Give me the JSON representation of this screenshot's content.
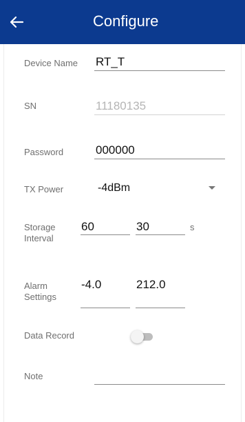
{
  "app_bar": {
    "title": "Configure",
    "back_icon": "arrow-left-icon",
    "background": "#0c3a8f"
  },
  "form": {
    "device_name": {
      "label": "Device Name",
      "value": "RT_T"
    },
    "sn": {
      "label": "SN",
      "value": "11180135"
    },
    "password": {
      "label": "Password",
      "value": "000000"
    },
    "tx_power": {
      "label": "TX Power",
      "value": "-4dBm",
      "dropdown_icon": "caret-down-icon"
    },
    "storage_interval": {
      "label_line1": "Storage",
      "label_line2": "Interval",
      "value_1": "60",
      "value_2": "30",
      "unit": "s"
    },
    "alarm_settings": {
      "label_line1": "Alarm",
      "label_line2": "Settings",
      "low": "-4.0",
      "high": "212.0"
    },
    "data_record": {
      "label": "Data Record",
      "enabled": false
    },
    "note": {
      "label": "Note",
      "value": ""
    }
  }
}
